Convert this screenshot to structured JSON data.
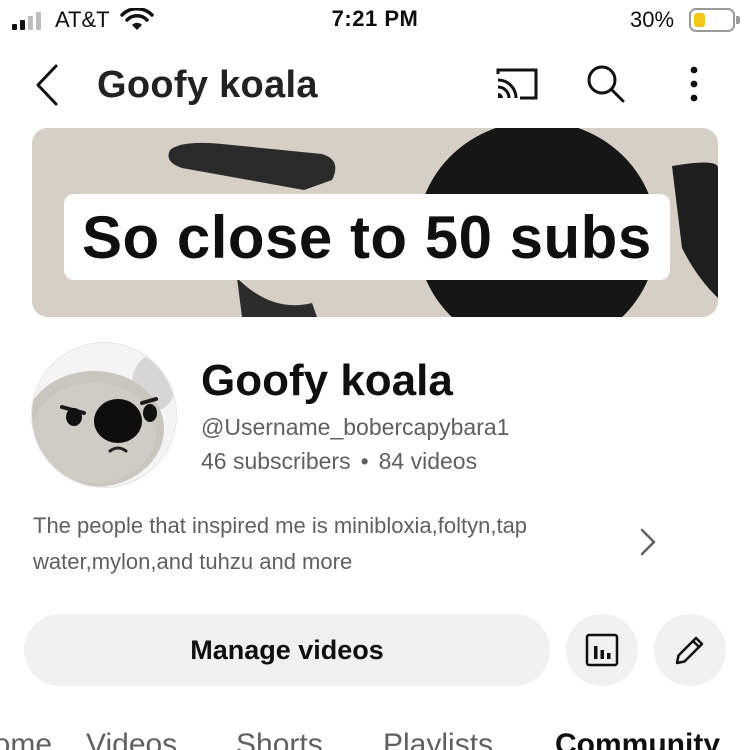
{
  "status_bar": {
    "carrier": "AT&T",
    "time": "7:21 PM",
    "battery_percent": "30%",
    "battery_level": 0.3,
    "signal_bars_active": 2,
    "signal_bars_total": 4,
    "icons": [
      "signal-icon",
      "wifi-icon",
      "battery-icon"
    ]
  },
  "app_bar": {
    "title": "Goofy koala",
    "icons": [
      "back-icon",
      "cast-icon",
      "search-icon",
      "more-vertical-icon"
    ]
  },
  "banner": {
    "text": "So close to 50 subs"
  },
  "channel": {
    "name": "Goofy koala",
    "handle": "@Username_bobercapybara1",
    "subscribers": "46 subscribers",
    "separator": "•",
    "videos": "84 videos",
    "description": "The people that inspired me is minibloxia,foltyn,tap water,mylon,and tuhzu and more"
  },
  "actions": {
    "manage_label": "Manage videos",
    "icons": [
      "analytics-icon",
      "edit-icon"
    ]
  },
  "tabs": [
    {
      "label": "Home"
    },
    {
      "label": "Videos"
    },
    {
      "label": "Shorts"
    },
    {
      "label": "Playlists"
    },
    {
      "label": "Community",
      "active": true
    }
  ],
  "colors": {
    "text_primary": "#0f0f0f",
    "text_secondary": "#606060",
    "button_bg": "#f1f1f1",
    "battery_fill": "#f5c518"
  }
}
